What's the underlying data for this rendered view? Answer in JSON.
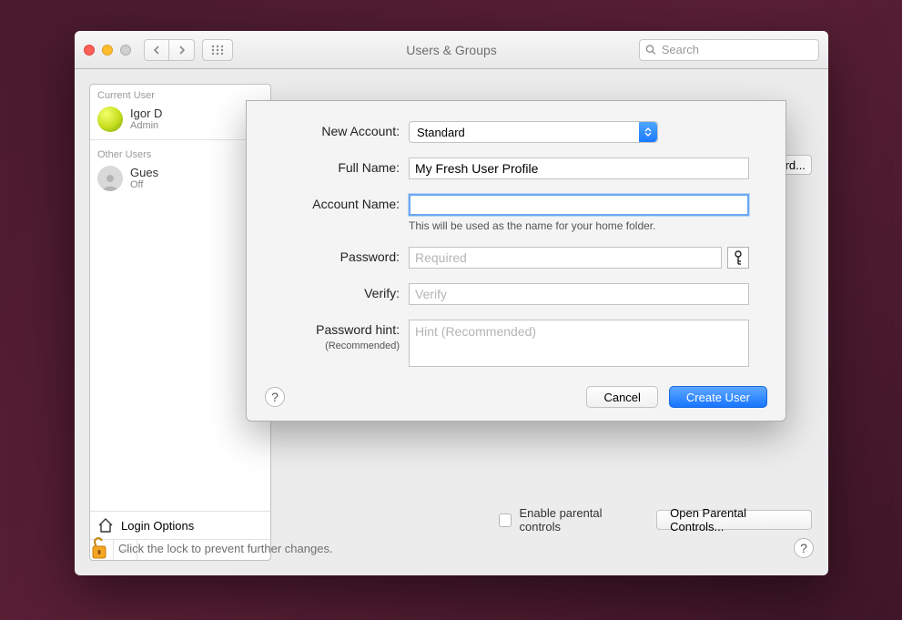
{
  "titlebar": {
    "window_title": "Users & Groups",
    "search_placeholder": "Search"
  },
  "sidebar": {
    "current_users_label": "Current User",
    "other_users_label": "Other Users",
    "items": [
      {
        "name": "Igor D",
        "subtitle": "Admin"
      },
      {
        "name": "Gues",
        "subtitle": "Off"
      }
    ],
    "login_options_label": "Login Options"
  },
  "main": {
    "change_password_partial": "ord...",
    "parental": {
      "enable_label": "Enable parental controls",
      "open_button_label": "Open Parental Controls..."
    }
  },
  "lock": {
    "text": "Click the lock to prevent further changes."
  },
  "sheet": {
    "new_account_label": "New Account:",
    "new_account_value": "Standard",
    "full_name_label": "Full Name:",
    "full_name_value": "My Fresh User Profile",
    "account_name_label": "Account Name:",
    "account_name_value": "",
    "account_name_hint": "This will be used as the name for your home folder.",
    "password_label": "Password:",
    "password_placeholder": "Required",
    "verify_label": "Verify:",
    "verify_placeholder": "Verify",
    "hint_label": "Password hint:",
    "hint_sub": "(Recommended)",
    "hint_placeholder": "Hint (Recommended)",
    "cancel_label": "Cancel",
    "create_label": "Create User"
  },
  "glyphs": {
    "question": "?",
    "plus": "+",
    "minus": "−"
  }
}
